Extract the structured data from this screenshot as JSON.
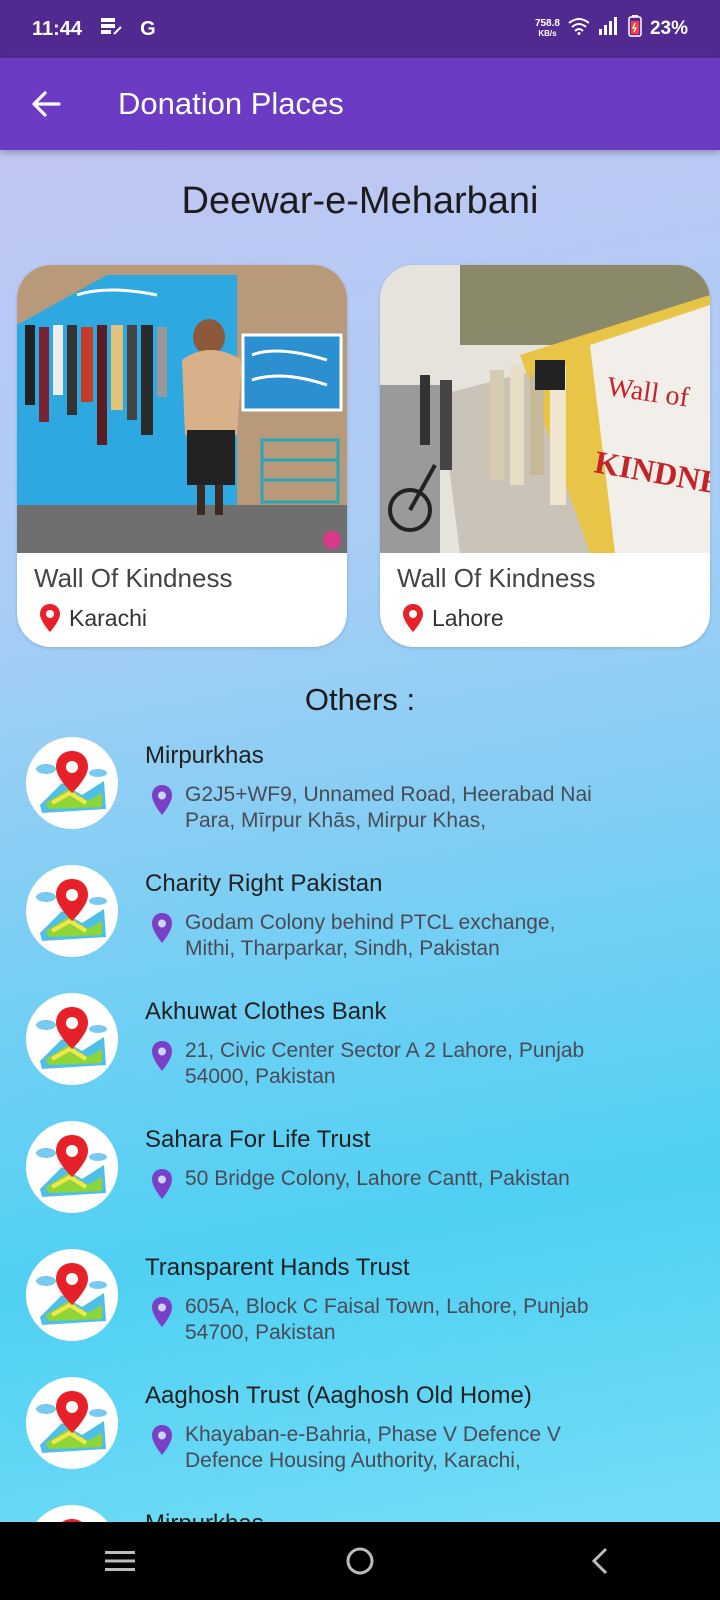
{
  "status_bar": {
    "time": "11:44",
    "carrier_icon": "G",
    "net_speed_value": "758.8",
    "net_speed_unit": "KB/s",
    "battery": "23%"
  },
  "app_bar": {
    "title": "Donation Places",
    "back_icon": "arrow-left-icon"
  },
  "featured": {
    "title": "Deewar-e-Meharbani",
    "cards": [
      {
        "title": "Wall Of Kindness",
        "location": "Karachi"
      },
      {
        "title": "Wall Of Kindness",
        "location": "Lahore"
      }
    ]
  },
  "others": {
    "title": "Others :",
    "items": [
      {
        "name": "Mirpurkhas",
        "address": "G2J5+WF9, Unnamed Road, Heerabad Nai Para, Mīrpur Khās, Mirpur Khas,"
      },
      {
        "name": "Charity Right Pakistan",
        "address": "Godam Colony behind PTCL exchange, Mithi, Tharparkar, Sindh, Pakistan"
      },
      {
        "name": "Akhuwat Clothes Bank",
        "address": "21, Civic Center Sector A 2 Lahore, Punjab 54000, Pakistan"
      },
      {
        "name": "Sahara For Life Trust",
        "address": "50 Bridge Colony, Lahore Cantt, Pakistan"
      },
      {
        "name": "Transparent Hands Trust",
        "address": "605A, Block C Faisal Town, Lahore, Punjab 54700, Pakistan"
      },
      {
        "name": "Aaghosh Trust (Aaghosh Old Home)",
        "address": "Khayaban-e-Bahria, Phase V Defence V Defence Housing Authority, Karachi,"
      },
      {
        "name": "Mirpurkhas",
        "address": ""
      }
    ]
  },
  "colors": {
    "status_bar": "#512a91",
    "app_bar": "#6c3bc3",
    "location_pin_red": "#e8202a",
    "address_pin_purple": "#7a3fc7"
  }
}
